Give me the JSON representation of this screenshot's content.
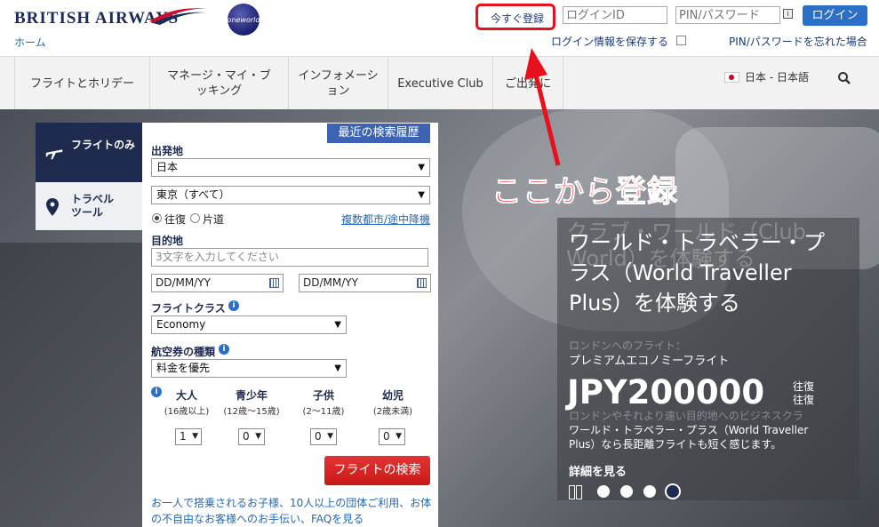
{
  "header": {
    "logo": "BRITISH AIRWAYS",
    "home": "ホーム",
    "oneworld": "oneworld",
    "register": "今すぐ登録",
    "login_id_placeholder": "ログインID",
    "pin_placeholder": "PIN/パスワード",
    "info_mini": "i",
    "login": "ログイン",
    "save_login": "ログイン情報を保存する",
    "forgot": "PIN/パスワードを忘れた場合"
  },
  "nav": {
    "items": [
      "フライトとホリデー",
      "マネージ・マイ・ブッキング",
      "インフォメーション",
      "Executive Club",
      "ご出発に"
    ],
    "language": "日本 - 日本語"
  },
  "tabs": {
    "flight": "フライトのみ",
    "travel": "トラベルツール"
  },
  "form": {
    "recent": "最近の検索履歴",
    "origin_label": "出発地",
    "origin_country": "日本",
    "origin_city": "東京（すべて）",
    "trip_round": "往復",
    "trip_oneway": "片道",
    "multi_city": "複数都市/途中降機",
    "dest_label": "目的地",
    "dest_placeholder": "3文字を入力してください",
    "date1": "DD/MM/YY",
    "date2": "DD/MM/YY",
    "class_label": "フライトクラス",
    "class_value": "Economy",
    "fare_label": "航空券の種類",
    "fare_value": "料金を優先",
    "pax": [
      {
        "name": "大人",
        "sub": "(16歳以上)",
        "count": "1"
      },
      {
        "name": "青少年",
        "sub": "(12歳～15歳)",
        "count": "0"
      },
      {
        "name": "子供",
        "sub": "(2～11歳)",
        "count": "0"
      },
      {
        "name": "幼児",
        "sub": "(2歳未満)",
        "count": "0"
      }
    ],
    "search": "フライトの検索",
    "footnote": "お一人で搭乗されるお子様、10人以上の団体ご利用、お体の不自由なお客様へのお手伝い、FAQを見る"
  },
  "annotation": "ここから登録",
  "promo": {
    "ghost_title": "クラブ・ワールド（Club World）を体験する",
    "title": "ワールド・トラベラー・プラス（World Traveller Plus）を体験する",
    "sub_ghost": "ロンドンへのフライト：",
    "sub": "プレミアムエコノミーフライト",
    "price": "JPY200000",
    "per": "往復",
    "per2": "往復",
    "desc_ghost": "ロンドンやそれより遠い目的地へのビジネスクラ",
    "desc": "ワールド・トラベラー・プラス（World Traveller Plus）なら長距離フライトも短く感じます。",
    "more": "詳細を見る"
  },
  "icons": [
    "plane-icon",
    "pin-icon",
    "search-icon",
    "info-icon",
    "calendar-icon",
    "pause-icon"
  ],
  "colors": {
    "navy": "#1e2b4f",
    "blue": "#2b6fc7",
    "red": "#e8101d"
  }
}
